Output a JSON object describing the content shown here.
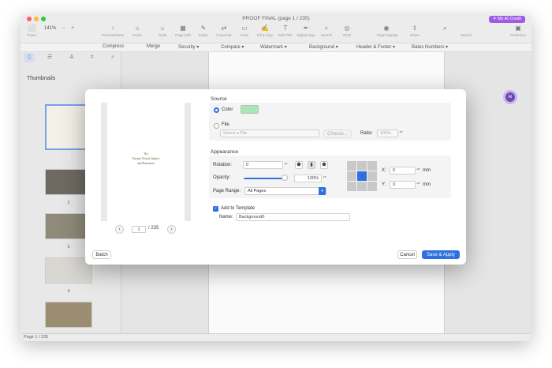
{
  "window": {
    "title": "PROOF FINAL (page 1 / 235)",
    "ai_credit_label": "✦ My AI Credit",
    "status": "Page 1 / 235"
  },
  "toolbar": {
    "zoom_value": "141%",
    "zoom_minus": "−",
    "zoom_plus": "+",
    "items": [
      {
        "icon": "⬜",
        "label": "Panel"
      },
      {
        "icon": "↑",
        "label": "Previous/Next"
      },
      {
        "icon": "⌂",
        "label": "Home"
      },
      {
        "icon": "⌂",
        "label": "Tools"
      },
      {
        "icon": "▦",
        "label": "Page Edit"
      },
      {
        "icon": "✎",
        "label": "Editor"
      },
      {
        "icon": "⇄",
        "label": "Converter"
      },
      {
        "icon": "▭",
        "label": "Form"
      },
      {
        "icon": "✍",
        "label": "Fill & Sign"
      },
      {
        "icon": "T",
        "label": "Edit PDF"
      },
      {
        "icon": "✒",
        "label": "Digital Sign"
      },
      {
        "icon": "⌕",
        "label": "Search"
      },
      {
        "icon": "◎",
        "label": "OCR"
      },
      {
        "icon": "◉",
        "label": "Page Display"
      },
      {
        "icon": "⇪",
        "label": "Share"
      },
      {
        "icon": "⌕",
        "label": "Search"
      },
      {
        "icon": "▣",
        "label": "Prediction"
      }
    ],
    "search_placeholder": "Search"
  },
  "subbar": {
    "items": [
      "Compress",
      "Merge",
      "Security ▾",
      "Compare ▾",
      "Watermark ▾",
      "Background ▾",
      "Header & Footer ▾",
      "Bates Numbers ▾"
    ]
  },
  "sidebar": {
    "thumbnails_title": "Thumbnails",
    "pages": [
      "1",
      "2",
      "3",
      "4",
      "5"
    ]
  },
  "dialog": {
    "preview_text": [
      "The",
      "Portrait, Period, Subject",
      "and Illustration"
    ],
    "page_current": "1",
    "page_total": "/ 235",
    "source_title": "Source",
    "color_label": "Color",
    "file_label": "File",
    "file_placeholder": "Select a File",
    "choose_button": "Choose...",
    "ratio_label": "Ratio:",
    "ratio_value": "100%",
    "appearance_title": "Appearance",
    "rotation_label": "Rotation:",
    "rotation_value": "0",
    "opacity_label": "Opacity:",
    "opacity_value": "100%",
    "page_range_label": "Page Range:",
    "page_range_value": "All Pages",
    "x_label": "X:",
    "x_value": "0",
    "y_label": "Y:",
    "y_value": "0",
    "unit": "mm",
    "add_template_label": "Add to Template",
    "name_label": "Name:",
    "name_value": "Background0",
    "batch_button": "Batch",
    "cancel_button": "Cancel",
    "save_button": "Save & Apply",
    "swatch_color": "#a9e6b3",
    "accent_color": "#2f6fe0",
    "opacity_fraction": 1.0
  }
}
